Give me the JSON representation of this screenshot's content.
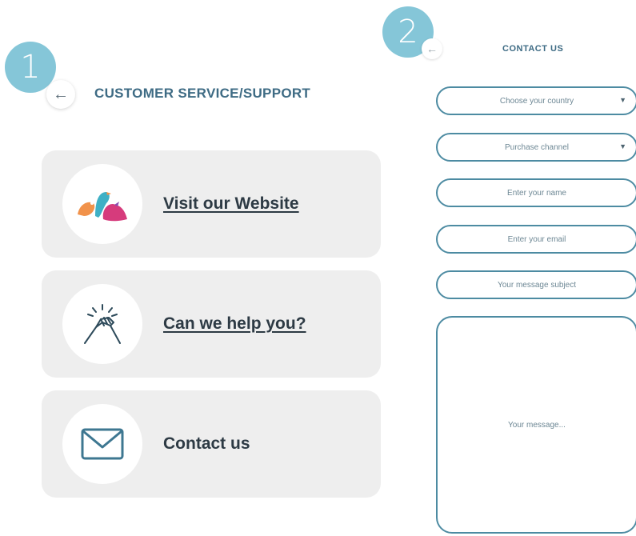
{
  "badges": {
    "step1": "1",
    "step2": "2"
  },
  "screen1": {
    "title": "CUSTOMER SERVICE/SUPPORT",
    "back_icon": "arrow-left-icon",
    "cards": [
      {
        "label": "Visit our Website",
        "icon": "birds-logo-icon"
      },
      {
        "label": "Can we help you?",
        "icon": "handshake-icon"
      },
      {
        "label": "Contact us",
        "icon": "envelope-icon"
      }
    ]
  },
  "screen2": {
    "title": "CONTACT US",
    "back_icon": "arrow-left-icon",
    "fields": {
      "country": "Choose your country",
      "channel": "Purchase channel",
      "name": "Enter your name",
      "email": "Enter your email",
      "subject": "Your message subject",
      "message": "Your message..."
    },
    "dropdown_icon": "caret-down-icon"
  },
  "colors": {
    "accent": "#3e6b84",
    "badge": "#7fc3d6",
    "field_border": "#4d8ba2",
    "card_bg": "#eeeeee"
  }
}
